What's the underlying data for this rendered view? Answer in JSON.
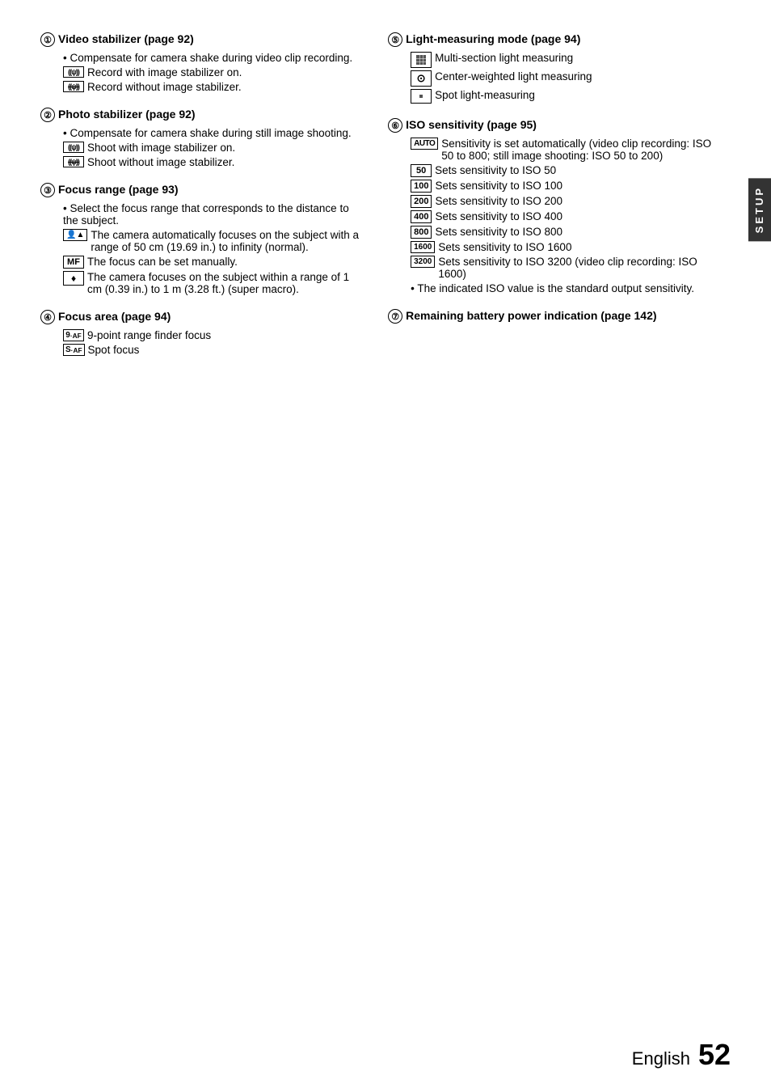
{
  "sidebar": {
    "label": "SETUP"
  },
  "footer": {
    "english": "English",
    "page_num": "52"
  },
  "left_col": {
    "sections": [
      {
        "num": "①",
        "title": "Video stabilizer (page 92)",
        "bullets": [
          "Compensate for camera shake during video clip recording."
        ],
        "icon_items": [
          {
            "icon": "((ψ))",
            "text": "Record with image stabilizer on."
          },
          {
            "icon": "((ψ))̶",
            "text": "Record without image stabilizer."
          }
        ]
      },
      {
        "num": "②",
        "title": "Photo stabilizer (page 92)",
        "bullets": [
          "Compensate for camera shake during still image shooting."
        ],
        "icon_items": [
          {
            "icon": "((ψ))",
            "text": "Shoot with image stabilizer on."
          },
          {
            "icon": "((ψ))̶",
            "text": "Shoot without image stabilizer."
          }
        ]
      },
      {
        "num": "③",
        "title": "Focus range (page 93)",
        "bullets": [
          "Select the focus range that corresponds to the distance to the subject."
        ],
        "icon_items": [
          {
            "icon": "👤▲",
            "text": "The camera automatically focuses on the subject with a range of 50 cm (19.69 in.) to infinity (normal)."
          },
          {
            "icon": "MF",
            "text": "The focus can be set manually."
          },
          {
            "icon": "♦",
            "text": "The camera focuses on the subject within a range of 1 cm (0.39 in.) to 1 m (3.28 ft.) (super macro)."
          }
        ]
      },
      {
        "num": "④",
        "title": "Focus area (page 94)",
        "icon_items": [
          {
            "icon": "9·AF",
            "text": "9-point range finder focus"
          },
          {
            "icon": "S·AF",
            "text": "Spot focus"
          }
        ]
      }
    ]
  },
  "right_col": {
    "sections": [
      {
        "num": "⑤",
        "title": "Light-measuring mode (page 94)",
        "icon_items": [
          {
            "icon": "⊞",
            "text": "Multi-section light measuring"
          },
          {
            "icon": "⊙",
            "text": "Center-weighted light measuring"
          },
          {
            "icon": "⊡",
            "text": "Spot light-measuring"
          }
        ]
      },
      {
        "num": "⑥",
        "title": "ISO sensitivity (page 95)",
        "icon_items": [
          {
            "icon": "AUTO",
            "text": "Sensitivity is set automatically (video clip recording: ISO 50 to 800; still image shooting: ISO 50 to 200)"
          },
          {
            "icon": "50",
            "text": "Sets sensitivity to ISO 50"
          },
          {
            "icon": "100",
            "text": "Sets sensitivity to ISO 100"
          },
          {
            "icon": "200",
            "text": "Sets sensitivity to ISO 200"
          },
          {
            "icon": "400",
            "text": "Sets sensitivity to ISO 400"
          },
          {
            "icon": "800",
            "text": "Sets sensitivity to ISO 800"
          },
          {
            "icon": "1600",
            "text": "Sets sensitivity to ISO 1600"
          },
          {
            "icon": "3200",
            "text": "Sets sensitivity to ISO 3200 (video clip recording: ISO 1600)"
          }
        ],
        "bullets": [
          "The indicated ISO value is the standard output sensitivity."
        ]
      },
      {
        "num": "⑦",
        "title": "Remaining battery power indication (page 142)"
      }
    ]
  }
}
